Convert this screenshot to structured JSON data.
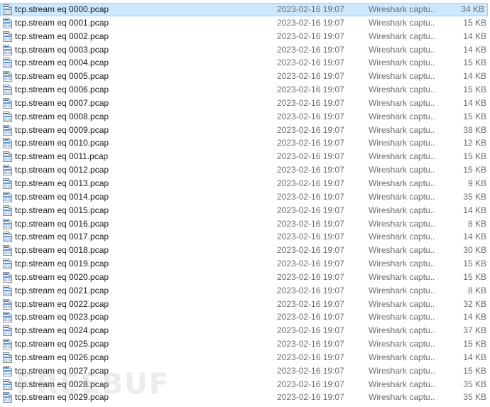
{
  "files": [
    {
      "name": "tcp.stream eq 0000.pcap",
      "modified": "2023-02-16 19:07",
      "type": "Wireshark captu...",
      "size": "34 KB",
      "selected": true
    },
    {
      "name": "tcp.stream eq 0001.pcap",
      "modified": "2023-02-16 19:07",
      "type": "Wireshark captu...",
      "size": "15 KB"
    },
    {
      "name": "tcp.stream eq 0002.pcap",
      "modified": "2023-02-16 19:07",
      "type": "Wireshark captu...",
      "size": "14 KB"
    },
    {
      "name": "tcp.stream eq 0003.pcap",
      "modified": "2023-02-16 19:07",
      "type": "Wireshark captu...",
      "size": "14 KB"
    },
    {
      "name": "tcp.stream eq 0004.pcap",
      "modified": "2023-02-16 19:07",
      "type": "Wireshark captu...",
      "size": "15 KB"
    },
    {
      "name": "tcp.stream eq 0005.pcap",
      "modified": "2023-02-16 19:07",
      "type": "Wireshark captu...",
      "size": "14 KB"
    },
    {
      "name": "tcp.stream eq 0006.pcap",
      "modified": "2023-02-16 19:07",
      "type": "Wireshark captu...",
      "size": "15 KB"
    },
    {
      "name": "tcp.stream eq 0007.pcap",
      "modified": "2023-02-16 19:07",
      "type": "Wireshark captu...",
      "size": "14 KB"
    },
    {
      "name": "tcp.stream eq 0008.pcap",
      "modified": "2023-02-16 19:07",
      "type": "Wireshark captu...",
      "size": "15 KB"
    },
    {
      "name": "tcp.stream eq 0009.pcap",
      "modified": "2023-02-16 19:07",
      "type": "Wireshark captu...",
      "size": "38 KB"
    },
    {
      "name": "tcp.stream eq 0010.pcap",
      "modified": "2023-02-16 19:07",
      "type": "Wireshark captu...",
      "size": "12 KB"
    },
    {
      "name": "tcp.stream eq 0011.pcap",
      "modified": "2023-02-16 19:07",
      "type": "Wireshark captu...",
      "size": "15 KB"
    },
    {
      "name": "tcp.stream eq 0012.pcap",
      "modified": "2023-02-16 19:07",
      "type": "Wireshark captu...",
      "size": "15 KB"
    },
    {
      "name": "tcp.stream eq 0013.pcap",
      "modified": "2023-02-16 19:07",
      "type": "Wireshark captu...",
      "size": "9 KB"
    },
    {
      "name": "tcp.stream eq 0014.pcap",
      "modified": "2023-02-16 19:07",
      "type": "Wireshark captu...",
      "size": "35 KB"
    },
    {
      "name": "tcp.stream eq 0015.pcap",
      "modified": "2023-02-16 19:07",
      "type": "Wireshark captu...",
      "size": "14 KB"
    },
    {
      "name": "tcp.stream eq 0016.pcap",
      "modified": "2023-02-16 19:07",
      "type": "Wireshark captu...",
      "size": "8 KB"
    },
    {
      "name": "tcp.stream eq 0017.pcap",
      "modified": "2023-02-16 19:07",
      "type": "Wireshark captu...",
      "size": "14 KB"
    },
    {
      "name": "tcp.stream eq 0018.pcap",
      "modified": "2023-02-16 19:07",
      "type": "Wireshark captu...",
      "size": "30 KB"
    },
    {
      "name": "tcp.stream eq 0019.pcap",
      "modified": "2023-02-16 19:07",
      "type": "Wireshark captu...",
      "size": "15 KB"
    },
    {
      "name": "tcp.stream eq 0020.pcap",
      "modified": "2023-02-16 19:07",
      "type": "Wireshark captu...",
      "size": "15 KB"
    },
    {
      "name": "tcp.stream eq 0021.pcap",
      "modified": "2023-02-16 19:07",
      "type": "Wireshark captu...",
      "size": "8 KB"
    },
    {
      "name": "tcp.stream eq 0022.pcap",
      "modified": "2023-02-16 19:07",
      "type": "Wireshark captu...",
      "size": "32 KB"
    },
    {
      "name": "tcp.stream eq 0023.pcap",
      "modified": "2023-02-16 19:07",
      "type": "Wireshark captu...",
      "size": "14 KB"
    },
    {
      "name": "tcp.stream eq 0024.pcap",
      "modified": "2023-02-16 19:07",
      "type": "Wireshark captu...",
      "size": "37 KB"
    },
    {
      "name": "tcp.stream eq 0025.pcap",
      "modified": "2023-02-16 19:07",
      "type": "Wireshark captu...",
      "size": "15 KB"
    },
    {
      "name": "tcp.stream eq 0026.pcap",
      "modified": "2023-02-16 19:07",
      "type": "Wireshark captu...",
      "size": "14 KB"
    },
    {
      "name": "tcp.stream eq 0027.pcap",
      "modified": "2023-02-16 19:07",
      "type": "Wireshark captu...",
      "size": "15 KB"
    },
    {
      "name": "tcp.stream eq 0028.pcap",
      "modified": "2023-02-16 19:07",
      "type": "Wireshark captu...",
      "size": "35 KB"
    },
    {
      "name": "tcp.stream eq 0029.pcap",
      "modified": "2023-02-16 19:07",
      "type": "Wireshark captu...",
      "size": "35 KB"
    }
  ],
  "icon": "pcap-file-icon",
  "colors": {
    "selection_bg": "#cce8ff",
    "selection_border": "#99d1ff",
    "icon_blue": "#3a78c2",
    "meta_text": "#6d6d6d"
  },
  "watermark": "FREEBUF"
}
